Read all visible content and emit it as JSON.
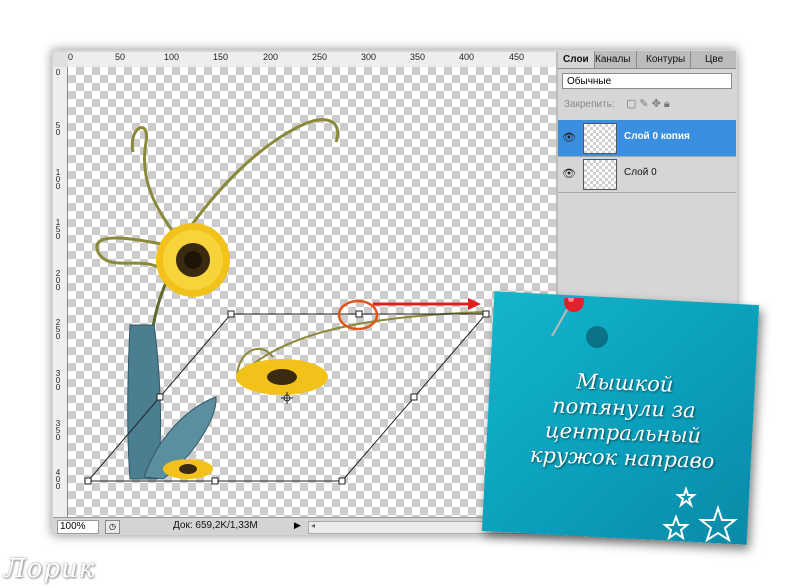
{
  "ruler_top": [
    "0",
    "50",
    "100",
    "150",
    "200",
    "250",
    "300",
    "350",
    "400",
    "450"
  ],
  "ruler_left": [
    "0",
    "5\n0",
    "1\n0\n0",
    "1\n5\n0",
    "2\n0\n0",
    "2\n5\n0",
    "3\n0\n0",
    "3\n5\n0",
    "4\n0\n0"
  ],
  "status": {
    "zoom": "100%",
    "doc": "Док: 659,2K/1,33M"
  },
  "panel": {
    "tabs": [
      "Слои",
      "Каналы",
      "Контуры",
      "Цве"
    ],
    "blend_mode": "Обычные",
    "lock_label": "Закрепить:",
    "layers": [
      {
        "name": "Слой 0 копия",
        "selected": true
      },
      {
        "name": "Слой 0",
        "selected": false
      }
    ]
  },
  "note": {
    "lines": [
      "Мышкой",
      "потянули за",
      "центральный",
      "кружок направо"
    ]
  },
  "watermark": "Лорик",
  "colors": {
    "selection": "#3b8fe0",
    "note": "#0fa9c4",
    "arrow": "#e02020"
  }
}
